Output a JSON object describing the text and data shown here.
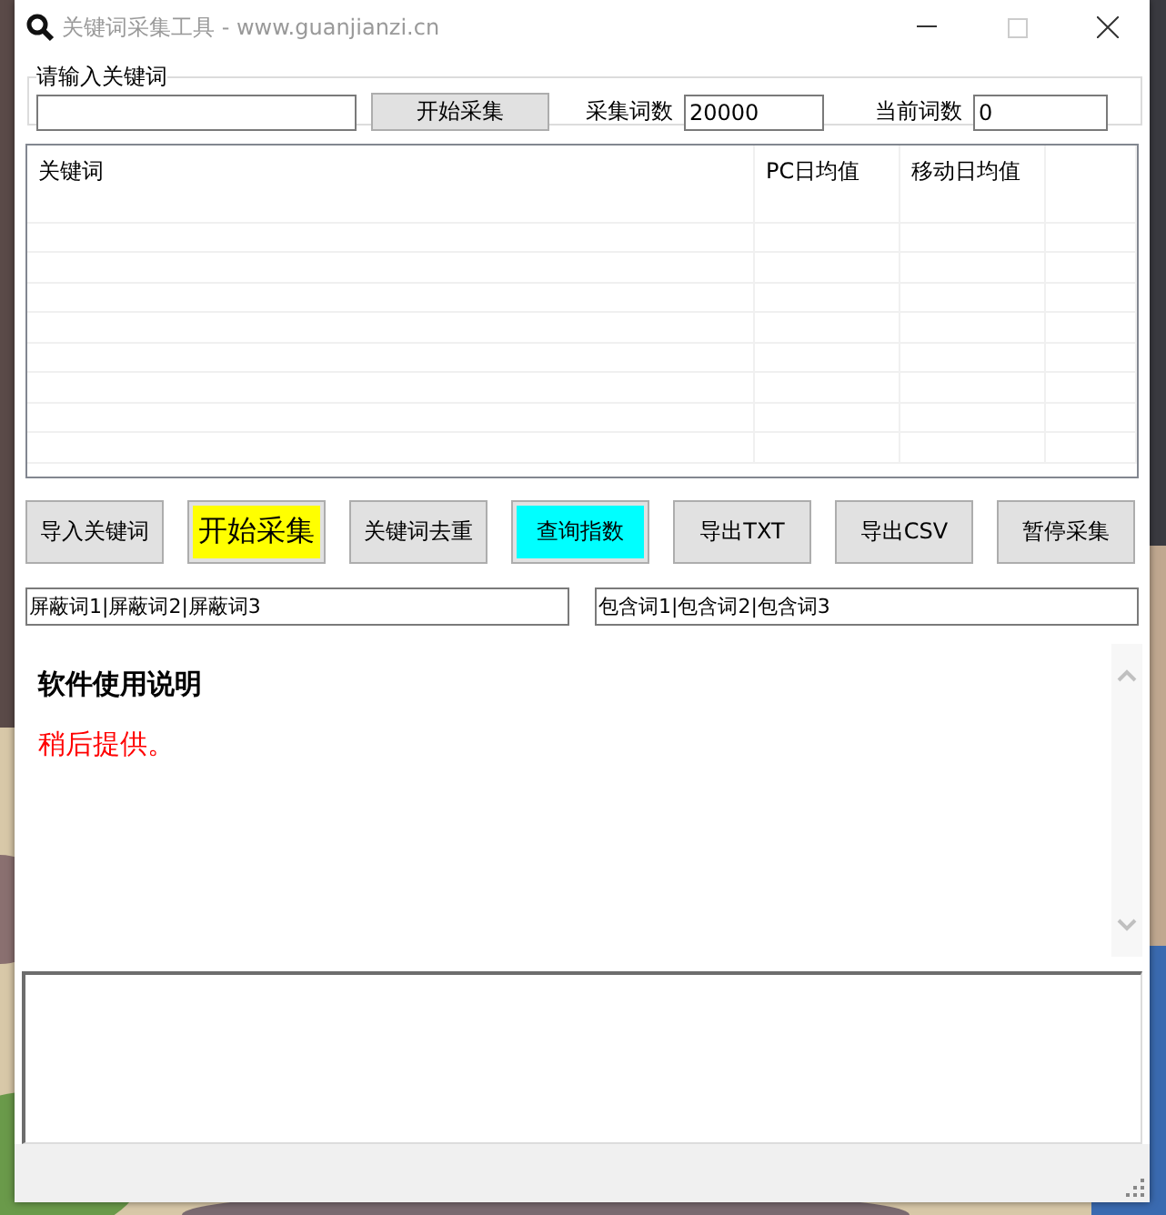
{
  "window": {
    "title": "关键词采集工具 - www.guanjianzi.cn"
  },
  "keyword_group": {
    "legend": "请输入关键词",
    "start_button": "开始采集",
    "count_label": "采集词数",
    "count_value": "20000",
    "current_label": "当前词数",
    "current_value": "0"
  },
  "table": {
    "columns": [
      "关键词",
      "PC日均值",
      "移动日均值"
    ]
  },
  "buttons": [
    {
      "label": "导入关键词",
      "color": "#e1e1e1"
    },
    {
      "label": "开始采集",
      "color": "#ffff00"
    },
    {
      "label": "关键词去重",
      "color": "#e1e1e1"
    },
    {
      "label": "查询指数",
      "color": "#00ffff"
    },
    {
      "label": "导出TXT",
      "color": "#e1e1e1"
    },
    {
      "label": "导出CSV",
      "color": "#e1e1e1"
    },
    {
      "label": "暂停采集",
      "color": "#e1e1e1"
    }
  ],
  "filters": {
    "blocked": "屏蔽词1|屏蔽词2|屏蔽词3",
    "included": "包含词1|包含词2|包含词3"
  },
  "help": {
    "title": "软件使用说明",
    "body": "稍后提供。"
  }
}
